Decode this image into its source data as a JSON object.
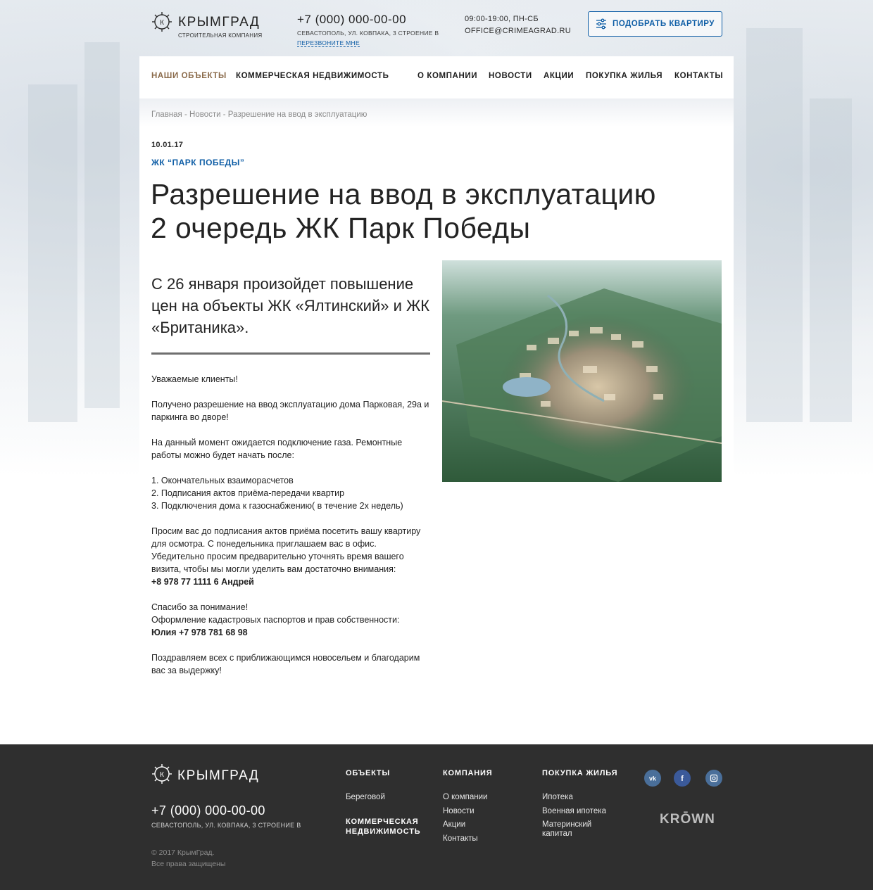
{
  "brand": {
    "name": "КРЫМГРАД",
    "subtitle": "СТРОИТЕЛЬНАЯ КОМПАНИЯ",
    "logo_letter": "К",
    "accent_color": "#0f5ea6",
    "active_nav_color": "#8a6a4a"
  },
  "header": {
    "phone": "+7 (000) 000-00-00",
    "address": "СЕВАСТОПОЛЬ, УЛ. КОВПАКА, 3 СТРОЕНИЕ В",
    "callback": "ПЕРЕЗВОНИТЕ МНЕ",
    "hours": "09:00-19:00, ПН-СБ",
    "email": "OFFICE@CRIMEAGRAD.RU",
    "pick_button": "ПОДОБРАТЬ КВАРТИРУ",
    "pick_icon": "sliders-icon"
  },
  "nav": {
    "items": [
      {
        "label": "НАШИ ОБЪЕКТЫ",
        "active": true
      },
      {
        "label": "КОММЕРЧЕСКАЯ НЕДВИЖИМОСТЬ"
      },
      {
        "label": "О КОМПАНИИ"
      },
      {
        "label": "НОВОСТИ"
      },
      {
        "label": "АКЦИИ"
      },
      {
        "label": "ПОКУПКА ЖИЛЬЯ"
      },
      {
        "label": "КОНТАКТЫ"
      }
    ]
  },
  "breadcrumb": {
    "home": "Главная",
    "sep": " - ",
    "news": "Новости",
    "current": "Разрешение на ввод в эксплуатацию"
  },
  "article": {
    "date": "10.01.17",
    "project": "ЖК “ПАРК ПОБЕДЫ”",
    "title_line1": "Разрешение на ввод в эксплуатацию",
    "title_line2": "2 очередь ЖК Парк Победы",
    "lead": "С 26 января произойдет повышение цен на объекты ЖК «Ялтинский» и ЖК «Британика».",
    "greeting": "Уважаемые клиенты!",
    "p1": "Получено разрешение на ввод эксплуатацию дома Парковая, 29а и паркинга во дворе!",
    "p2": "На данный момент ожидается подключение газа. Ремонтные работы можно будет начать после:",
    "list": [
      "1. Окончательных взаиморасчетов",
      "2. Подписания актов приёма-передачи квартир",
      "3. Подключения дома к газоснабжению( в течение 2х недель)"
    ],
    "p3": "Просим вас до подписания актов приёма посетить вашу квартиру для осмотра. С понедельника приглашаем вас в офис.  Убедительно просим  предварительно уточнять время вашего визита, чтобы мы могли уделить вам достаточно внимания:",
    "contact1": "+8 978 77 1111 6 Андрей",
    "thanks": "Спасибо за понимание!",
    "cadastral": "Оформление кадастровых паспортов и прав собственности:",
    "contact2": "Юлия  +7 978 781 68 98",
    "closing": "Поздравляем всех с приближающимся новосельем и благодарим вас за выдержку!"
  },
  "footer": {
    "phone": "+7 (000) 000-00-00",
    "address": "СЕВАСТОПОЛЬ, УЛ. КОВПАКА, 3 СТРОЕНИЕ В",
    "copyright": "© 2017 КрымГрад.",
    "rights": "Все права защищены",
    "objects_title": "ОБЪЕКТЫ",
    "objects_link": "Береговой",
    "commercial_title": "КОММЕРЧЕСКАЯ НЕДВИЖИМОСТЬ",
    "company_title": "КОМПАНИЯ",
    "company_links": [
      "О компании",
      "Новости",
      "Акции",
      "Контакты"
    ],
    "buy_title": "ПОКУПКА ЖИЛЬЯ",
    "buy_links": [
      "Ипотека",
      "Военная ипотека",
      "Материнский капитал"
    ],
    "social": [
      "vk-icon",
      "facebook-icon",
      "instagram-icon"
    ],
    "partner": "KRŌWN"
  }
}
